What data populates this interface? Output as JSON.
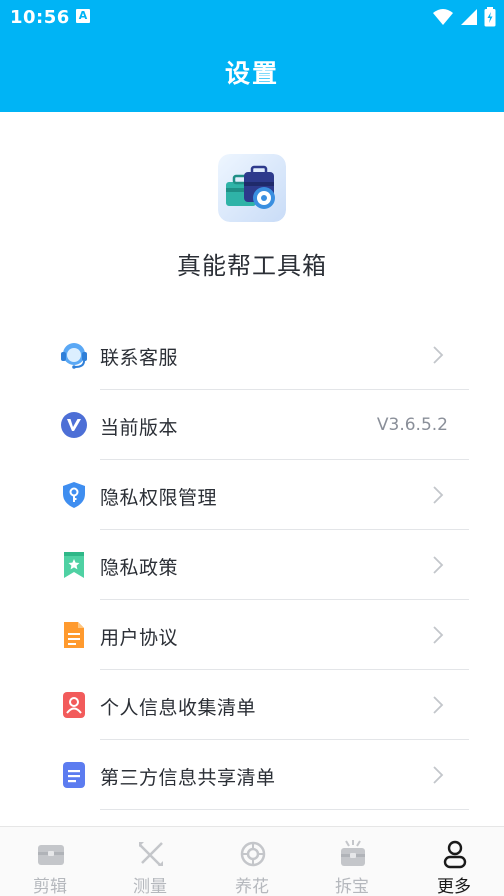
{
  "status_bar": {
    "time": "10:56",
    "notification_icon": "A"
  },
  "header": {
    "title": "设置"
  },
  "app": {
    "name": "真能帮工具箱"
  },
  "menu": {
    "items": [
      {
        "label": "联系客服",
        "icon": "headset-icon",
        "has_arrow": true
      },
      {
        "label": "当前版本",
        "icon": "version-v-icon",
        "value": "V3.6.5.2",
        "has_arrow": false
      },
      {
        "label": "隐私权限管理",
        "icon": "shield-key-icon",
        "has_arrow": true
      },
      {
        "label": "隐私政策",
        "icon": "bookmark-star-icon",
        "has_arrow": true
      },
      {
        "label": "用户协议",
        "icon": "document-icon",
        "has_arrow": true
      },
      {
        "label": "个人信息收集清单",
        "icon": "person-card-icon",
        "has_arrow": true
      },
      {
        "label": "第三方信息共享清单",
        "icon": "list-doc-icon",
        "has_arrow": true
      }
    ]
  },
  "tabbar": {
    "tabs": [
      {
        "label": "剪辑",
        "icon": "briefcase-icon",
        "active": false
      },
      {
        "label": "测量",
        "icon": "ruler-cross-icon",
        "active": false
      },
      {
        "label": "养花",
        "icon": "flower-icon",
        "active": false
      },
      {
        "label": "拆宝",
        "icon": "gift-box-icon",
        "active": false
      },
      {
        "label": "更多",
        "icon": "person-outline-icon",
        "active": true
      }
    ]
  },
  "colors": {
    "accent": "#00b4f5",
    "text": "#2b2f36",
    "muted": "#8a8f99",
    "tab_inactive": "#b5b8bd"
  }
}
